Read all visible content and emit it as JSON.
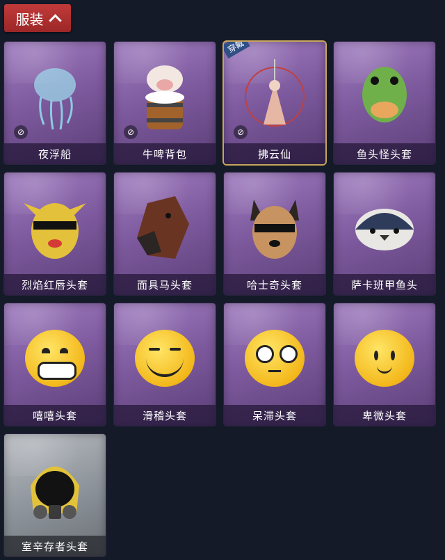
{
  "header": {
    "title": "服装"
  },
  "badge": {
    "equipped": "穿戴"
  },
  "items": [
    {
      "name": "夜浮船",
      "hidden": true
    },
    {
      "name": "牛啤背包",
      "hidden": true
    },
    {
      "name": "拂云仙",
      "hidden": true,
      "equipped": true
    },
    {
      "name": "鱼头怪头套"
    },
    {
      "name": "烈焰红唇头套"
    },
    {
      "name": "面具马头套"
    },
    {
      "name": "哈士奇头套"
    },
    {
      "name": "萨卡班甲鱼头"
    },
    {
      "name": "嘻嘻头套"
    },
    {
      "name": "滑稽头套"
    },
    {
      "name": "呆滞头套"
    },
    {
      "name": "卑微头套"
    },
    {
      "name": "室辛存者头套",
      "grey": true
    }
  ]
}
